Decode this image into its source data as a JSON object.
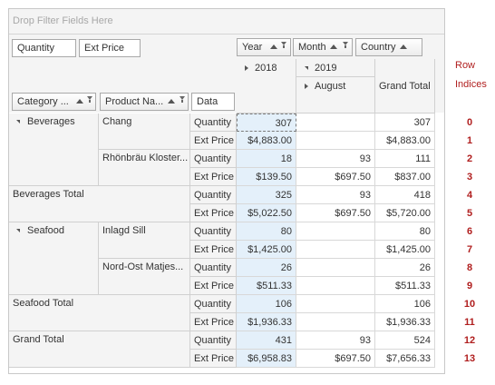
{
  "filter_area": {
    "placeholder": "Drop Filter Fields Here"
  },
  "data_fields": [
    "Quantity",
    "Ext Price"
  ],
  "column_fields": [
    "Year",
    "Month",
    "Country"
  ],
  "row_fields": [
    "Category ...",
    "Product Na...",
    "Data"
  ],
  "column_headers": {
    "year_2018": "2018",
    "year_2019": "2019",
    "month_august": "August",
    "grand_total": "Grand Total"
  },
  "row_index_header": {
    "line1": "Row",
    "line2": "Indices"
  },
  "row_groups": [
    {
      "label": "Beverages",
      "expanded": true
    },
    {
      "label": "Beverages Total"
    },
    {
      "label": "Seafood",
      "expanded": true
    },
    {
      "label": "Seafood Total"
    },
    {
      "label": "Grand Total"
    }
  ],
  "products": [
    "Chang",
    "Rhönbräu Kloster...",
    "Inlagd Sill",
    "Nord-Ost Matjes..."
  ],
  "rows": [
    {
      "data": "Quantity",
      "v2018": "307",
      "v2019": "",
      "total": "307",
      "index": "0"
    },
    {
      "data": "Ext Price",
      "v2018": "$4,883.00",
      "v2019": "",
      "total": "$4,883.00",
      "index": "1"
    },
    {
      "data": "Quantity",
      "v2018": "18",
      "v2019": "93",
      "total": "111",
      "index": "2"
    },
    {
      "data": "Ext Price",
      "v2018": "$139.50",
      "v2019": "$697.50",
      "total": "$837.00",
      "index": "3"
    },
    {
      "data": "Quantity",
      "v2018": "325",
      "v2019": "93",
      "total": "418",
      "index": "4"
    },
    {
      "data": "Ext Price",
      "v2018": "$5,022.50",
      "v2019": "$697.50",
      "total": "$5,720.00",
      "index": "5"
    },
    {
      "data": "Quantity",
      "v2018": "80",
      "v2019": "",
      "total": "80",
      "index": "6"
    },
    {
      "data": "Ext Price",
      "v2018": "$1,425.00",
      "v2019": "",
      "total": "$1,425.00",
      "index": "7"
    },
    {
      "data": "Quantity",
      "v2018": "26",
      "v2019": "",
      "total": "26",
      "index": "8"
    },
    {
      "data": "Ext Price",
      "v2018": "$511.33",
      "v2019": "",
      "total": "$511.33",
      "index": "9"
    },
    {
      "data": "Quantity",
      "v2018": "106",
      "v2019": "",
      "total": "106",
      "index": "10"
    },
    {
      "data": "Ext Price",
      "v2018": "$1,936.33",
      "v2019": "",
      "total": "$1,936.33",
      "index": "11"
    },
    {
      "data": "Quantity",
      "v2018": "431",
      "v2019": "93",
      "total": "524",
      "index": "12"
    },
    {
      "data": "Ext Price",
      "v2018": "$6,958.83",
      "v2019": "$697.50",
      "total": "$7,656.33",
      "index": "13"
    }
  ],
  "colors": {
    "header_bg": "#f4f4f4",
    "highlight_col": "#e4f0fa",
    "index_text": "#b01e1e",
    "grid_line": "#d0d0d0"
  }
}
